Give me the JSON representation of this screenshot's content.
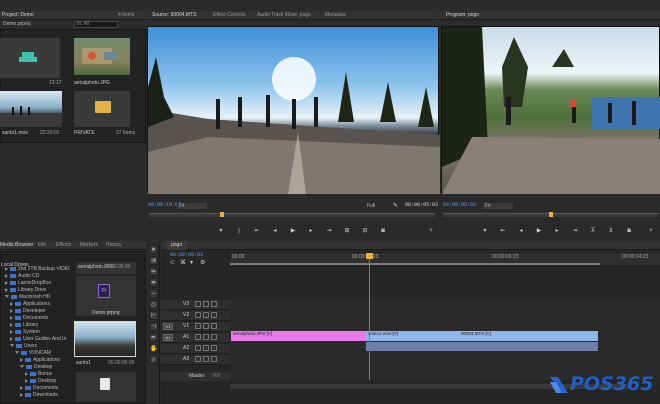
{
  "project_panel": {
    "tab_label": "Project: Demo",
    "project_file": "Demo.prproj",
    "item_count": "4 Items",
    "search_label": "In: All",
    "items": [
      {
        "name": "aerialphoto.JPG",
        "meta": ""
      },
      {
        "name": "",
        "meta": "12:17"
      },
      {
        "name": "sunIo1.mov",
        "meta": "22:20:01"
      },
      {
        "name": "PRIVATE",
        "meta": "27 Items"
      }
    ]
  },
  "source_monitor": {
    "tabs": [
      "Source: 00004.MTS",
      "Effect Controls",
      "Audio Track Mixer: pogo",
      "Metadata"
    ],
    "timecode": "00:00:10:07",
    "fit": "Fit",
    "quality": "Full",
    "duration": "00:00:05:03"
  },
  "program_monitor": {
    "tab": "Program: pogo",
    "timecode": "00:00:05:03",
    "fit": "Fit"
  },
  "media_browser": {
    "tabs": [
      "Media Browser",
      "Info",
      "Effects",
      "Markers",
      "History"
    ],
    "drives_title": "Local Drives",
    "tree": [
      {
        "label": "2nd 2TB Backup VIDEO",
        "depth": 1,
        "open": false
      },
      {
        "label": "Audio CD",
        "depth": 1,
        "open": false
      },
      {
        "label": "LamieDropBox",
        "depth": 1,
        "open": false
      },
      {
        "label": "Library Drive",
        "depth": 1,
        "open": false
      },
      {
        "label": "Macintosh HD",
        "depth": 1,
        "open": true
      },
      {
        "label": "Applications",
        "depth": 2,
        "open": false
      },
      {
        "label": "Developer",
        "depth": 2,
        "open": false
      },
      {
        "label": "Documents",
        "depth": 2,
        "open": false
      },
      {
        "label": "Library",
        "depth": 2,
        "open": false
      },
      {
        "label": "System",
        "depth": 2,
        "open": false
      },
      {
        "label": "User Guides And In",
        "depth": 2,
        "open": false
      },
      {
        "label": "Users",
        "depth": 2,
        "open": true
      },
      {
        "label": "VONCAM",
        "depth": 3,
        "open": true
      },
      {
        "label": "Applications",
        "depth": 4,
        "open": false
      },
      {
        "label": "Desktop",
        "depth": 4,
        "open": true
      },
      {
        "label": "Bonus",
        "depth": 5,
        "open": false
      },
      {
        "label": "Desktop",
        "depth": 5,
        "open": false
      },
      {
        "label": "Documents",
        "depth": 4,
        "open": false
      },
      {
        "label": "Downloads",
        "depth": 4,
        "open": false
      }
    ],
    "thumbs": [
      {
        "name": "aerialphoto.JPG",
        "meta": "00:00:05:00"
      },
      {
        "name": "Demo.prproj",
        "meta": ""
      },
      {
        "name": "sunIo1",
        "meta": "00:00:00:00"
      },
      {
        "name": "",
        "meta": ""
      }
    ]
  },
  "timeline": {
    "tab": "pogo",
    "timecode": "00:00:05:03",
    "ruler": [
      "00:00",
      "00:00:04:23",
      "00:00:09:23",
      "00:00:14:23"
    ],
    "video_tracks": [
      "V3",
      "V2",
      "V1"
    ],
    "audio_tracks": [
      "A1",
      "A2",
      "A3"
    ],
    "master_label": "Master",
    "master_value": "0.0",
    "source_badges": [
      "V1",
      "A1"
    ],
    "clips": [
      {
        "label": "aerialphoto.JPG [V]",
        "track": "V1",
        "color": "#e879e8"
      },
      {
        "label": "sunIo1.mov [V]",
        "track": "V1",
        "color": "#8fb6e8"
      },
      {
        "label": "00004.MTS [V]",
        "track": "V1",
        "color": "#8fb6e8"
      },
      {
        "label": "",
        "track": "A1",
        "color": "#7b8fb8"
      }
    ]
  },
  "watermark": {
    "text": "POS365"
  },
  "colors": {
    "accent_blue": "#5aa0ff",
    "playhead": "#e8b13a",
    "clip_pink": "#e879e8",
    "clip_blue": "#8fb6e8"
  }
}
